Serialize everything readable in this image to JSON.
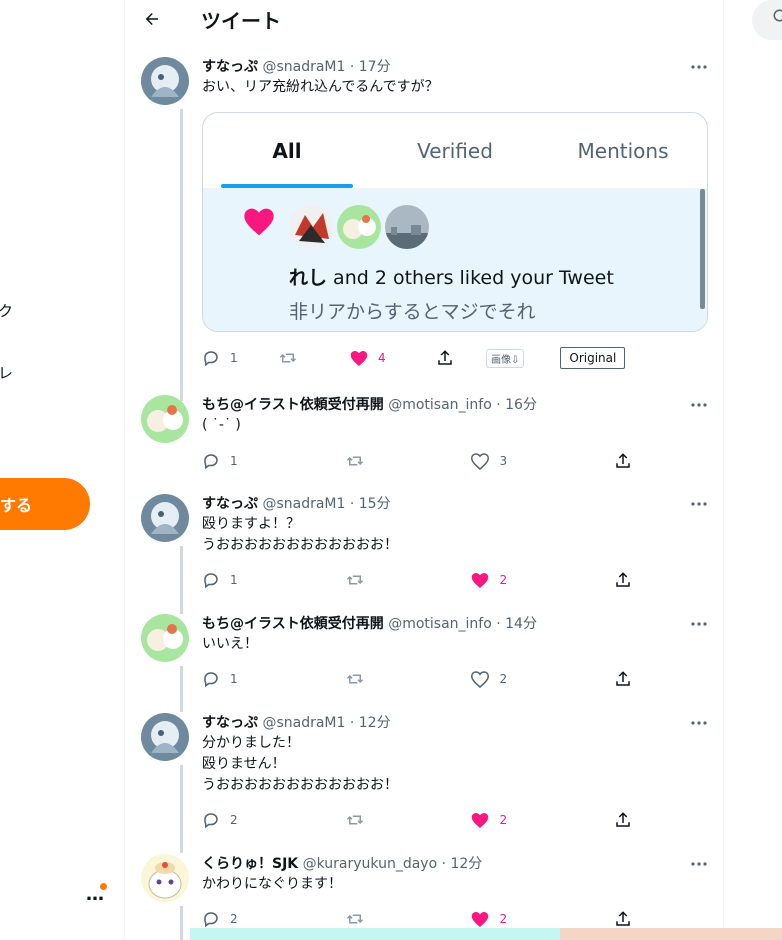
{
  "header": {
    "title": "ツイート"
  },
  "leftnav": {
    "frag1": "ク",
    "frag2": "レ",
    "post_label": "する",
    "more": "…"
  },
  "main_tweet": {
    "name": "すなっぷ",
    "handle": "@snadraM1",
    "time": "· 17分",
    "text": "おい、リア充紛れ込んでるんですが？",
    "card": {
      "tabs": [
        "All",
        "Verified",
        "Mentions"
      ],
      "active_tab": "All",
      "liker_name": "れし",
      "liked_text": " and 2 others liked your Tweet",
      "quote": "非リアからするとマジでそれ"
    },
    "reply_count": "1",
    "like_count": "4",
    "image_button": "画像⇩",
    "original_button": "Original"
  },
  "replies": [
    {
      "name": "もち@イラスト依頼受付再開",
      "handle": "@motisan_info",
      "time": "· 16分",
      "lines": [
        "( ˙-˙ )"
      ],
      "reply_count": "1",
      "like_count": "3",
      "liked": false
    },
    {
      "name": "すなっぷ",
      "handle": "@snadraM1",
      "time": "· 15分",
      "lines": [
        "殴りますよ！？",
        "うおおおおおおおおおおおお！"
      ],
      "reply_count": "1",
      "like_count": "2",
      "liked": true
    },
    {
      "name": "もち@イラスト依頼受付再開",
      "handle": "@motisan_info",
      "time": "· 14分",
      "lines": [
        "いいえ！"
      ],
      "reply_count": "1",
      "like_count": "2",
      "liked": false
    },
    {
      "name": "すなっぷ",
      "handle": "@snadraM1",
      "time": "· 12分",
      "lines": [
        "分かりました！",
        "殴りません！",
        "うおおおおおおおおおおおお！"
      ],
      "reply_count": "2",
      "like_count": "2",
      "liked": true
    },
    {
      "name": "くらりゅ！SJK",
      "handle": "@kuraryukun_dayo",
      "time": "· 12分",
      "lines": [
        "かわりになぐります！"
      ],
      "reply_count": "2",
      "like_count": "2",
      "liked": true
    }
  ],
  "colors": {
    "accent": "#1d9bf0",
    "like": "#f91880",
    "post_button": "#ff7a00"
  }
}
